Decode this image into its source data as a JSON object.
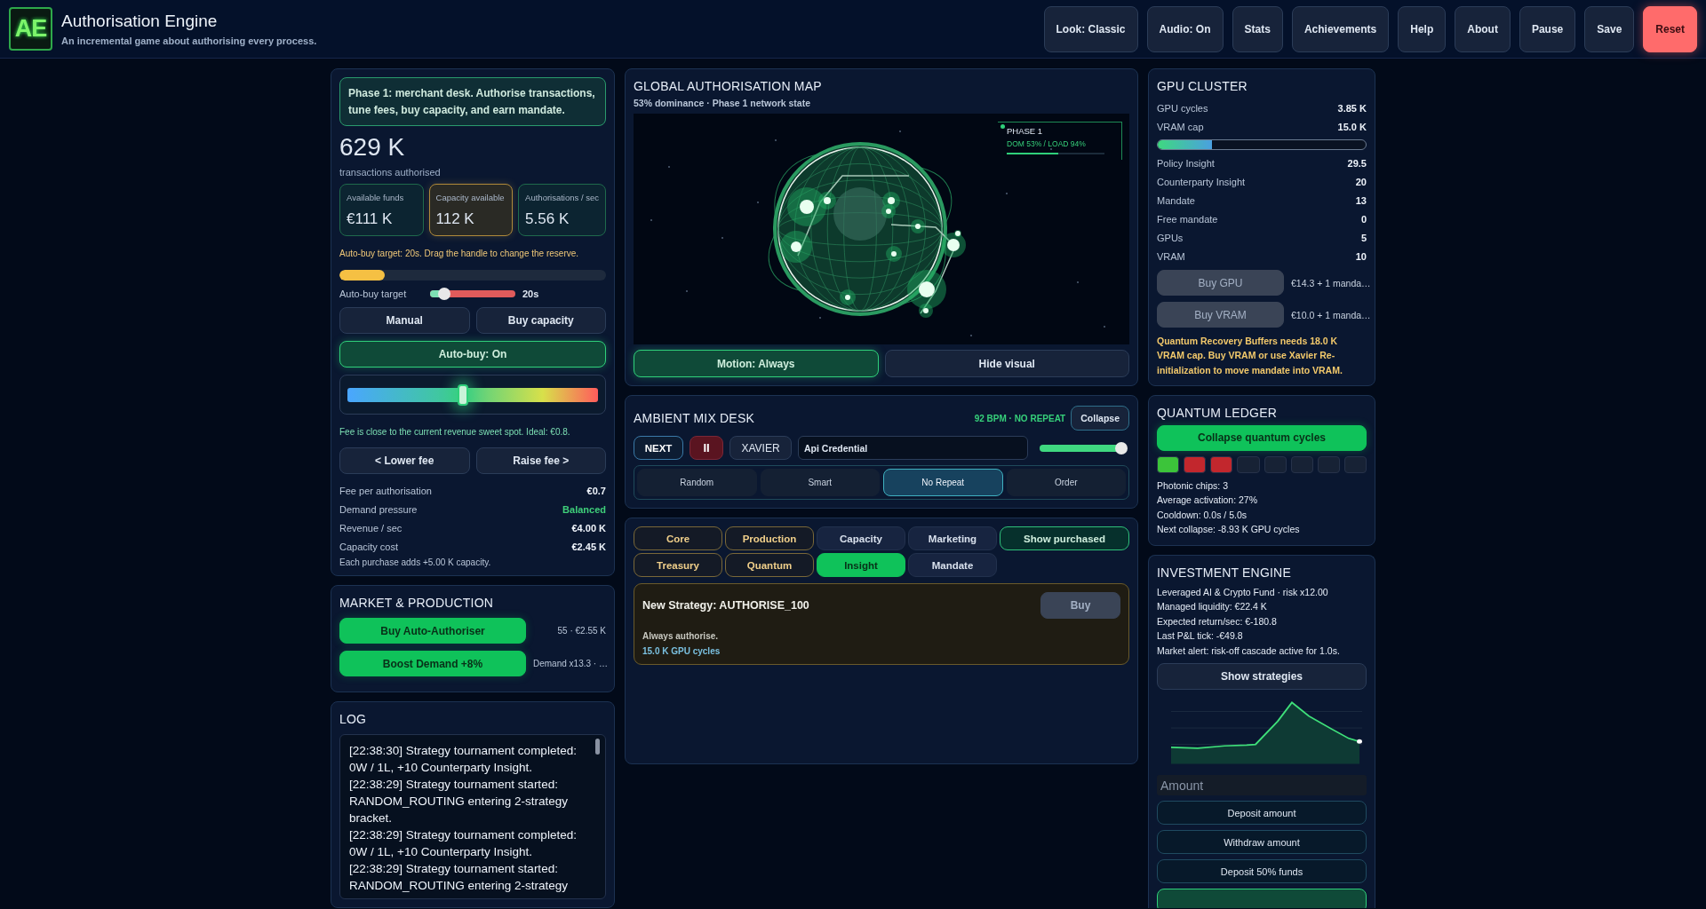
{
  "header": {
    "logo": "AE",
    "title": "Authorisation Engine",
    "subtitle": "An incremental game about authorising every process.",
    "buttons": [
      {
        "label": "Look: Classic",
        "kind": "normal"
      },
      {
        "label": "Audio: On",
        "kind": "normal"
      },
      {
        "label": "Stats",
        "kind": "normal"
      },
      {
        "label": "Achievements",
        "kind": "normal"
      },
      {
        "label": "Help",
        "kind": "normal"
      },
      {
        "label": "About",
        "kind": "normal"
      },
      {
        "label": "Pause",
        "kind": "normal"
      },
      {
        "label": "Save",
        "kind": "normal"
      },
      {
        "label": "Reset",
        "kind": "danger"
      }
    ]
  },
  "merchant": {
    "phase_note": "Phase 1: merchant desk. Authorise transactions, tune fees, buy capacity, and earn mandate.",
    "total": "629 K",
    "total_label": "transactions authorised",
    "stats": [
      {
        "label": "Available funds",
        "value": "€111 K",
        "highlighted": false
      },
      {
        "label": "Capacity available",
        "value": "112 K",
        "highlighted": true
      },
      {
        "label": "Authorisations / sec",
        "value": "5.56 K",
        "highlighted": false
      }
    ],
    "autobuy_note": "Auto-buy target: 20s. Drag the handle to change the reserve.",
    "capacity_bar": {
      "level": 0.17
    },
    "autobuy_slider": {
      "label": "Auto-buy target",
      "level": 0.17,
      "reading": "20s"
    },
    "mode_buttons": [
      "Manual",
      "Buy capacity"
    ],
    "autobuy_toggle": {
      "label": "Auto-buy: On",
      "on": true
    },
    "fee_slider": {
      "level": 0.46
    },
    "fee_note": "Fee is close to the current revenue sweet spot. Ideal: €0.8.",
    "fee_buttons": [
      "< Lower fee",
      "Raise fee >"
    ],
    "rows": [
      {
        "label": "Fee per authorisation",
        "value": "€0.7",
        "highlighted": false
      },
      {
        "label": "Demand pressure",
        "value": "Balanced",
        "highlighted": true
      },
      {
        "label": "Revenue / sec",
        "value": "€4.00 K",
        "highlighted": false
      },
      {
        "label": "Capacity cost",
        "value": "€2.45 K",
        "highlighted": false
      }
    ],
    "footnote": "Each purchase adds +5.00 K capacity."
  },
  "market": {
    "title": "MARKET & PRODUCTION",
    "actions": [
      {
        "label": "Buy Auto-Authoriser",
        "detail": "55 · €2.55 K"
      },
      {
        "label": "Boost Demand +8%",
        "detail": "Demand x13.3 · …"
      }
    ]
  },
  "log": {
    "title": "LOG",
    "lines": [
      "[22:38:30] Strategy tournament completed: 0W / 1L, +10 Counterparty Insight.",
      "[22:38:29] Strategy tournament started: RANDOM_ROUTING entering 2-strategy bracket.",
      "[22:38:29] Strategy tournament completed: 0W / 1L, +10 Counterparty Insight.",
      "[22:38:29] Strategy tournament started: RANDOM_ROUTING entering 2-strategy"
    ]
  },
  "map": {
    "title": "GLOBAL AUTHORISATION MAP",
    "subtitle": "53% dominance · Phase 1 network state",
    "overlay": {
      "phase": "PHASE 1",
      "stats": "DOM 53% / LOAD 94%",
      "level": 0.53
    },
    "buttons": [
      {
        "label": "Motion: Always",
        "on": true
      },
      {
        "label": "Hide visual",
        "on": false
      }
    ]
  },
  "mix": {
    "title": "AMBIENT MIX DESK",
    "status": "92 BPM · NO REPEAT",
    "collapse": "Collapse",
    "next": "NEXT",
    "pause": "II",
    "artist": "XAVIER",
    "track": "Api Credential",
    "volume": {
      "level": 0.97
    },
    "modes": [
      {
        "label": "Random",
        "selected": false
      },
      {
        "label": "Smart",
        "selected": false
      },
      {
        "label": "No Repeat",
        "selected": true
      },
      {
        "label": "Order",
        "selected": false
      }
    ]
  },
  "upgrades": {
    "tabs": [
      {
        "label": "Core",
        "kind": "gold",
        "selected": false
      },
      {
        "label": "Production",
        "kind": "gold",
        "selected": false
      },
      {
        "label": "Capacity",
        "kind": "plain",
        "selected": false
      },
      {
        "label": "Marketing",
        "kind": "plain",
        "selected": false
      },
      {
        "label": "Treasury",
        "kind": "gold",
        "selected": false
      },
      {
        "label": "Quantum",
        "kind": "gold",
        "selected": false
      },
      {
        "label": "Insight",
        "kind": "plain",
        "selected": true
      },
      {
        "label": "Mandate",
        "kind": "plain",
        "selected": false
      }
    ],
    "show_purchased": "Show purchased",
    "card": {
      "title": "New Strategy: AUTHORISE_100",
      "description": "Always authorise.",
      "cost": "15.0 K GPU cycles",
      "buy": {
        "label": "Buy",
        "disabled": true
      }
    }
  },
  "gpu": {
    "title": "GPU CLUSTER",
    "rows": [
      {
        "label": "GPU cycles",
        "value": "3.85 K"
      },
      {
        "label": "VRAM cap",
        "value": "15.0 K"
      }
    ],
    "vram_bar": {
      "level": 0.26
    },
    "rows2": [
      {
        "label": "Policy Insight",
        "value": "29.5"
      },
      {
        "label": "Counterparty Insight",
        "value": "20"
      },
      {
        "label": "Mandate",
        "value": "13"
      },
      {
        "label": "Free mandate",
        "value": "0"
      },
      {
        "label": "GPUs",
        "value": "5"
      },
      {
        "label": "VRAM",
        "value": "10"
      }
    ],
    "buys": [
      {
        "label": "Buy GPU",
        "cost": "€14.3 + 1 manda…",
        "disabled": true
      },
      {
        "label": "Buy VRAM",
        "cost": "€10.0 + 1 manda…",
        "disabled": true
      }
    ],
    "warning": "Quantum Recovery Buffers needs 18.0 K VRAM cap. Buy VRAM or use Xavier Re-initialization to move mandate into VRAM."
  },
  "quantum": {
    "title": "QUANTUM LEDGER",
    "collapse": "Collapse quantum cycles",
    "chips": [
      {
        "color": "#3cc43a"
      },
      {
        "color": "#c2272d"
      },
      {
        "color": "#c2272d"
      },
      {
        "color": "#172235"
      },
      {
        "color": "#172235"
      },
      {
        "color": "#172235"
      },
      {
        "color": "#172235"
      },
      {
        "color": "#172235"
      }
    ],
    "lines": [
      "Photonic chips: 3",
      "Average activation: 27%",
      "Cooldown: 0.0s / 5.0s",
      "Next collapse: -8.93 K GPU cycles"
    ]
  },
  "invest": {
    "title": "INVESTMENT ENGINE",
    "lines": [
      "Leveraged AI & Crypto Fund · risk x12.00",
      "Managed liquidity: €22.4 K",
      "Expected return/sec: €-180.8",
      "Last P&L tick: -€49.8",
      "Market alert: risk-off cascade active for 1.0s."
    ],
    "show_button": "Show strategies",
    "amount": {
      "placeholder": "Amount"
    },
    "actions": [
      {
        "label": "Deposit amount",
        "kind": "outline"
      },
      {
        "label": "Withdraw amount",
        "kind": "outline"
      },
      {
        "label": "Deposit 50% funds",
        "kind": "outline"
      },
      {
        "kind": "primary"
      }
    ]
  }
}
